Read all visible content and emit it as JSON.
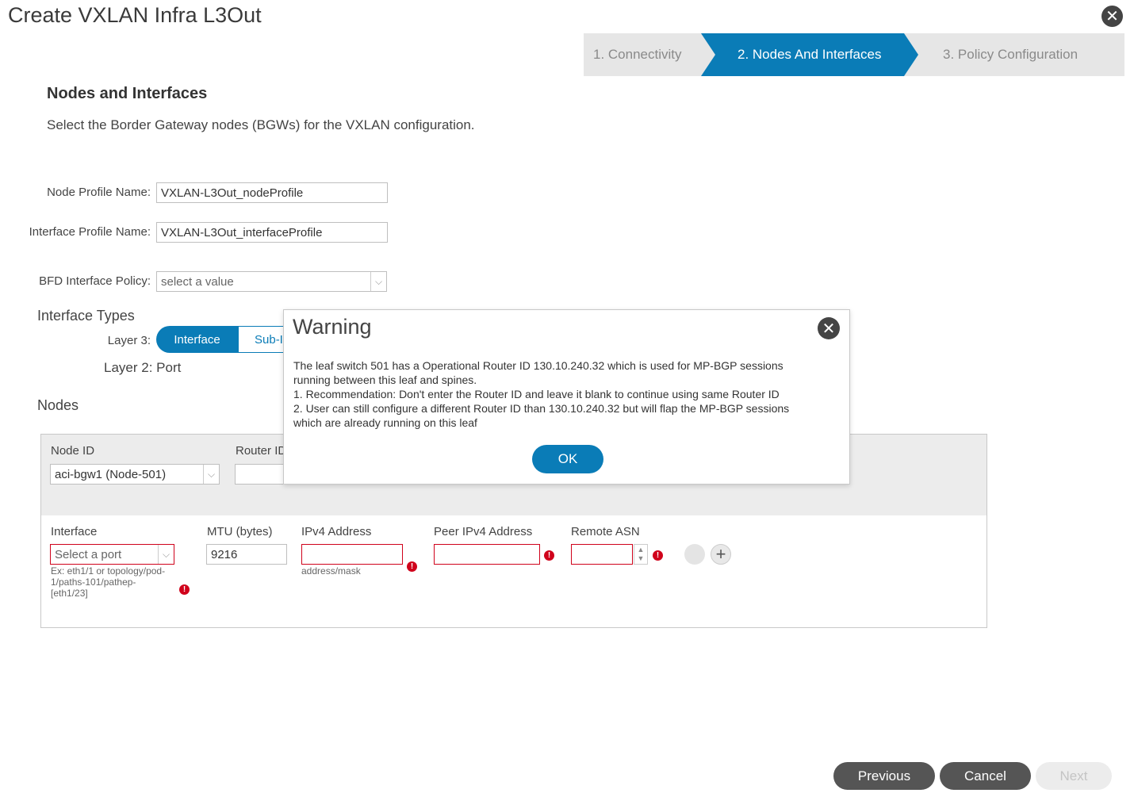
{
  "window": {
    "title": "Create VXLAN Infra L3Out"
  },
  "wizard": {
    "steps": [
      {
        "label": "1. Connectivity"
      },
      {
        "label": "2. Nodes And Interfaces"
      },
      {
        "label": "3. Policy Configuration"
      }
    ],
    "active_step": 2
  },
  "section": {
    "title": "Nodes and Interfaces",
    "description": "Select the Border Gateway nodes (BGWs) for the VXLAN configuration."
  },
  "form": {
    "node_profile_label": "Node Profile Name:",
    "node_profile_value": "VXLAN-L3Out_nodeProfile",
    "interface_profile_label": "Interface Profile Name:",
    "interface_profile_value": "VXLAN-L3Out_interfaceProfile",
    "bfd_label": "BFD Interface Policy:",
    "bfd_value": "select a value"
  },
  "interface_types": {
    "title": "Interface Types",
    "layer3_label": "Layer 3:",
    "layer3_options": [
      "Interface",
      "Sub-I"
    ],
    "layer2_text": "Layer 2: Port"
  },
  "nodes": {
    "title": "Nodes",
    "node_id_label": "Node ID",
    "node_id_value": "aci-bgw1 (Node-501)",
    "router_id_label": "Router ID",
    "interface_label": "Interface",
    "interface_placeholder": "Select a port",
    "interface_hint": [
      "Ex: eth1/1 or topology/pod-",
      "1/paths-101/pathep-",
      "[eth1/23]"
    ],
    "mtu_label": "MTU (bytes)",
    "mtu_value": "9216",
    "ipv4_label": "IPv4 Address",
    "ipv4_hint": "address/mask",
    "peer_ipv4_label": "Peer IPv4 Address",
    "remote_asn_label": "Remote ASN"
  },
  "warning_modal": {
    "title": "Warning",
    "lines": [
      "The leaf switch 501 has a Operational Router ID 130.10.240.32 which is used for MP-BGP sessions",
      "running between this leaf and spines.",
      "1. Recommendation: Don't enter the Router ID and leave it blank to continue using same Router ID",
      "2. User can still configure a different Router ID than 130.10.240.32 but will flap the MP-BGP sessions",
      "which are already running on this leaf"
    ],
    "ok_label": "OK"
  },
  "footer": {
    "previous_label": "Previous",
    "cancel_label": "Cancel",
    "next_label": "Next"
  },
  "colors": {
    "accent": "#0a7cb7",
    "error": "#d0021b",
    "dark_button": "#555555"
  }
}
